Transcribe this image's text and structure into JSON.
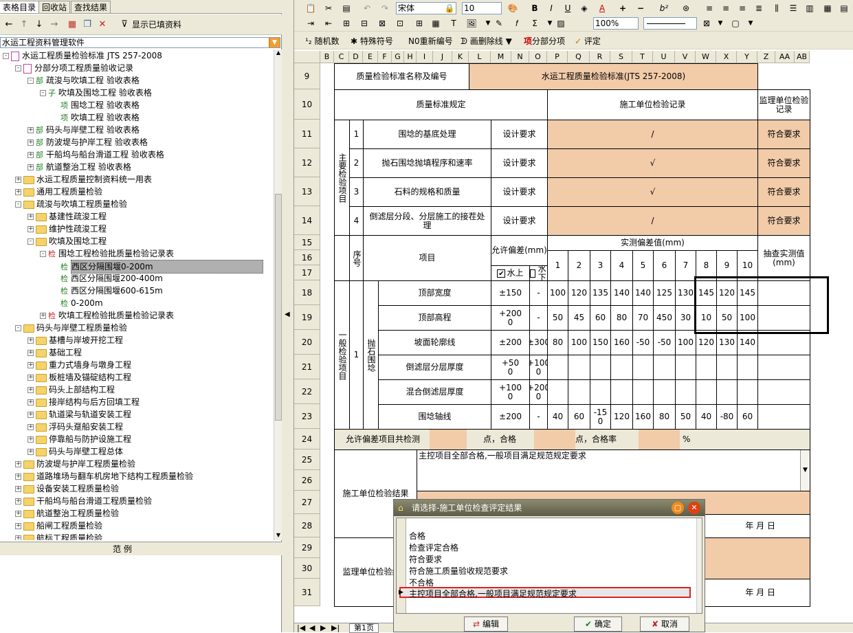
{
  "left_tabs": [
    "表格目录",
    "回收站",
    "查找结果"
  ],
  "left_toolbar": {
    "show_filled_label": "显示已填资料"
  },
  "software_combo": "水运工程资料管理软件",
  "tree": [
    {
      "t": "水运工程质量检验标准 JTS 257-2008",
      "lvl": 0,
      "kind": "doc",
      "exp": "-"
    },
    {
      "t": "分部分项工程质量验收记录",
      "lvl": 1,
      "kind": "doc",
      "exp": "-"
    },
    {
      "t": "疏浚与吹填工程 验收表格",
      "lvl": 2,
      "kind": "部",
      "exp": "-"
    },
    {
      "t": "吹填及围埝工程 验收表格",
      "lvl": 3,
      "kind": "子",
      "exp": "-"
    },
    {
      "t": "围埝工程 验收表格",
      "lvl": 4,
      "kind": "项",
      "exp": ""
    },
    {
      "t": "吹填工程 验收表格",
      "lvl": 4,
      "kind": "项",
      "exp": ""
    },
    {
      "t": "码头与岸壁工程 验收表格",
      "lvl": 2,
      "kind": "部",
      "exp": "+"
    },
    {
      "t": "防波堤与护岸工程 验收表格",
      "lvl": 2,
      "kind": "部",
      "exp": "+"
    },
    {
      "t": "干船坞与船台滑道工程 验收表格",
      "lvl": 2,
      "kind": "部",
      "exp": "+"
    },
    {
      "t": "航道整治工程 验收表格",
      "lvl": 2,
      "kind": "部",
      "exp": "+"
    },
    {
      "t": "水运工程质量控制资料统一用表",
      "lvl": 1,
      "kind": "folder",
      "exp": "+"
    },
    {
      "t": "通用工程质量检验",
      "lvl": 1,
      "kind": "folder",
      "exp": "+"
    },
    {
      "t": "疏浚与吹填工程质量检验",
      "lvl": 1,
      "kind": "folder",
      "exp": "-"
    },
    {
      "t": "基建性疏浚工程",
      "lvl": 2,
      "kind": "folder",
      "exp": "+"
    },
    {
      "t": "维护性疏浚工程",
      "lvl": 2,
      "kind": "folder",
      "exp": "+"
    },
    {
      "t": "吹填及围埝工程",
      "lvl": 2,
      "kind": "folder",
      "exp": "-"
    },
    {
      "t": "围埝工程检验批质量检验记录表",
      "lvl": 3,
      "kind": "检r",
      "exp": "-"
    },
    {
      "t": "西区分隔围堰0-200m",
      "lvl": 4,
      "kind": "检",
      "exp": "",
      "sel": true
    },
    {
      "t": "西区分隔围堰200-400m",
      "lvl": 4,
      "kind": "检",
      "exp": ""
    },
    {
      "t": "西区分隔围堰600-615m",
      "lvl": 4,
      "kind": "检",
      "exp": ""
    },
    {
      "t": "0-200m",
      "lvl": 4,
      "kind": "检",
      "exp": ""
    },
    {
      "t": "吹填工程检验批质量检验记录表",
      "lvl": 3,
      "kind": "检r",
      "exp": "+"
    },
    {
      "t": "码头与岸壁工程质量检验",
      "lvl": 1,
      "kind": "folder",
      "exp": "-"
    },
    {
      "t": "基槽与岸坡开挖工程",
      "lvl": 2,
      "kind": "folder",
      "exp": "+"
    },
    {
      "t": "基础工程",
      "lvl": 2,
      "kind": "folder",
      "exp": "+"
    },
    {
      "t": "重力式墙身与墩身工程",
      "lvl": 2,
      "kind": "folder",
      "exp": "+"
    },
    {
      "t": "板桩墙及锚碇结构工程",
      "lvl": 2,
      "kind": "folder",
      "exp": "+"
    },
    {
      "t": "码头上部结构工程",
      "lvl": 2,
      "kind": "folder",
      "exp": "+"
    },
    {
      "t": "接岸结构与后方回填工程",
      "lvl": 2,
      "kind": "folder",
      "exp": "+"
    },
    {
      "t": "轨道梁与轨道安装工程",
      "lvl": 2,
      "kind": "folder",
      "exp": "+"
    },
    {
      "t": "浮码头趸船安装工程",
      "lvl": 2,
      "kind": "folder",
      "exp": "+"
    },
    {
      "t": "停靠船与防护设施工程",
      "lvl": 2,
      "kind": "folder",
      "exp": "+"
    },
    {
      "t": "码头与岸壁工程总体",
      "lvl": 2,
      "kind": "folder",
      "exp": "+"
    },
    {
      "t": "防波堤与护岸工程质量检验",
      "lvl": 1,
      "kind": "folder",
      "exp": "+"
    },
    {
      "t": "道路堆场与翻车机房地下结构工程质量检验",
      "lvl": 1,
      "kind": "folder",
      "exp": "+"
    },
    {
      "t": "设备安装工程质量检验",
      "lvl": 1,
      "kind": "folder",
      "exp": "+"
    },
    {
      "t": "干船坞与船台滑道工程质量检验",
      "lvl": 1,
      "kind": "folder",
      "exp": "+"
    },
    {
      "t": "航道整治工程质量检验",
      "lvl": 1,
      "kind": "folder",
      "exp": "+"
    },
    {
      "t": "船闸工程质量检验",
      "lvl": 1,
      "kind": "folder",
      "exp": "+"
    },
    {
      "t": "航标工程质量检验",
      "lvl": 1,
      "kind": "folder",
      "exp": "+"
    }
  ],
  "footer_tab": "范          例",
  "font_name": "宋体",
  "font_size": "10",
  "zoom": "100%",
  "toolbar3": {
    "random": "随机数",
    "special": "特殊符号",
    "renumber": "重新编号",
    "strike": "画删除线",
    "split": "分部分项",
    "eval": "评定"
  },
  "col_headers": [
    "B",
    "C",
    "D",
    "E",
    "F",
    "G",
    "H",
    "I",
    "J",
    "K",
    "L",
    "M",
    "N",
    "O",
    "P",
    "Q",
    "R",
    "S",
    "T",
    "U",
    "V",
    "W",
    "X",
    "Y",
    "Z",
    "AA",
    "AB"
  ],
  "row_numbers": [
    "9",
    "10",
    "11",
    "12",
    "13",
    "14",
    "15",
    "16",
    "17",
    "18",
    "19",
    "20",
    "21",
    "22",
    "23",
    "24",
    "25",
    "26",
    "27",
    "28",
    "29",
    "30",
    "31"
  ],
  "form": {
    "std_label": "质量检验标准名称及编号",
    "std_value": "水运工程质量检验标准(JTS 257-2008)",
    "quality_std": "质量标准规定",
    "contractor_record": "施工单位检验记录",
    "supervisor_record": "监理单位检验记录",
    "main_items": "主要检验项目",
    "main_rows": [
      {
        "no": "1",
        "item": "围埝的基底处理",
        "req": "设计要求",
        "rec": "/",
        "sup": "符合要求"
      },
      {
        "no": "2",
        "item": "抛石围埝抛填程序和速率",
        "req": "设计要求",
        "rec": "√",
        "sup": "符合要求"
      },
      {
        "no": "3",
        "item": "石料的规格和质量",
        "req": "设计要求",
        "rec": "√",
        "sup": "符合要求"
      },
      {
        "no": "4",
        "item": "倒滤层分段、分层施工的接茬处理",
        "req": "设计要求",
        "rec": "/",
        "sup": "符合要求"
      }
    ],
    "seq": "序号",
    "project": "项目",
    "tolerance": "允许偏差(mm)",
    "measured": "实测偏差值(mm)",
    "sample": "抽查实测值(mm)",
    "above_water": "水上",
    "below_water": "水下",
    "idx": [
      "1",
      "2",
      "3",
      "4",
      "5",
      "6",
      "7",
      "8",
      "9",
      "10"
    ],
    "general_items": "一般检验项目",
    "group_no": "1",
    "group_name": "抛石围埝",
    "gen_rows": [
      {
        "item": "顶部宽度",
        "up": "±150",
        "dn": "-",
        "v": [
          "100",
          "120",
          "135",
          "140",
          "140",
          "125",
          "130",
          "145",
          "120",
          "145"
        ]
      },
      {
        "item": "顶部高程",
        "up": "+200\n0",
        "dn": "-",
        "v": [
          "50",
          "45",
          "60",
          "80",
          "70",
          "450",
          "30",
          "10",
          "50",
          "100"
        ]
      },
      {
        "item": "坡面轮廓线",
        "up": "±200",
        "dn": "±300",
        "v": [
          "80",
          "100",
          "150",
          "160",
          "-50",
          "-50",
          "100",
          "120",
          "130",
          "140"
        ]
      },
      {
        "item": "倒滤层分层厚度",
        "up": "+50\n0",
        "dn": "+100\n0",
        "v": [
          "",
          "",
          "",
          "",
          "",
          "",
          "",
          "",
          "",
          ""
        ]
      },
      {
        "item": "混合倒滤层厚度",
        "up": "+100\n0",
        "dn": "+200\n0",
        "v": [
          "",
          "",
          "",
          "",
          "",
          "",
          "",
          "",
          "",
          ""
        ]
      },
      {
        "item": "围埝轴线",
        "up": "±200",
        "dn": "-",
        "v": [
          "40",
          "60",
          "-15\n0",
          "120",
          "160",
          "80",
          "50",
          "40",
          "-80",
          "60"
        ]
      }
    ],
    "tol_total": "允许偏差项目共检测",
    "points_pass": "点，合格",
    "points_rate": "点，合格率",
    "percent": "%",
    "contractor_result": "施工单位检验结果",
    "contractor_text": "主控项目全部合格,一般项目满足规范规定要求",
    "date_label": "年   月   日",
    "supervisor_result": "监理单位检验结论"
  },
  "sheet_tab": "第1页",
  "dialog": {
    "title": "请选择-施工单位检查评定结果",
    "options": [
      "合格",
      "检查评定合格",
      "符合要求",
      "符合施工质量验收规范要求",
      "不合格",
      "主控项目全部合格,一般项目满足规范规定要求"
    ],
    "edit": "编辑",
    "ok": "确定",
    "cancel": "取消"
  }
}
